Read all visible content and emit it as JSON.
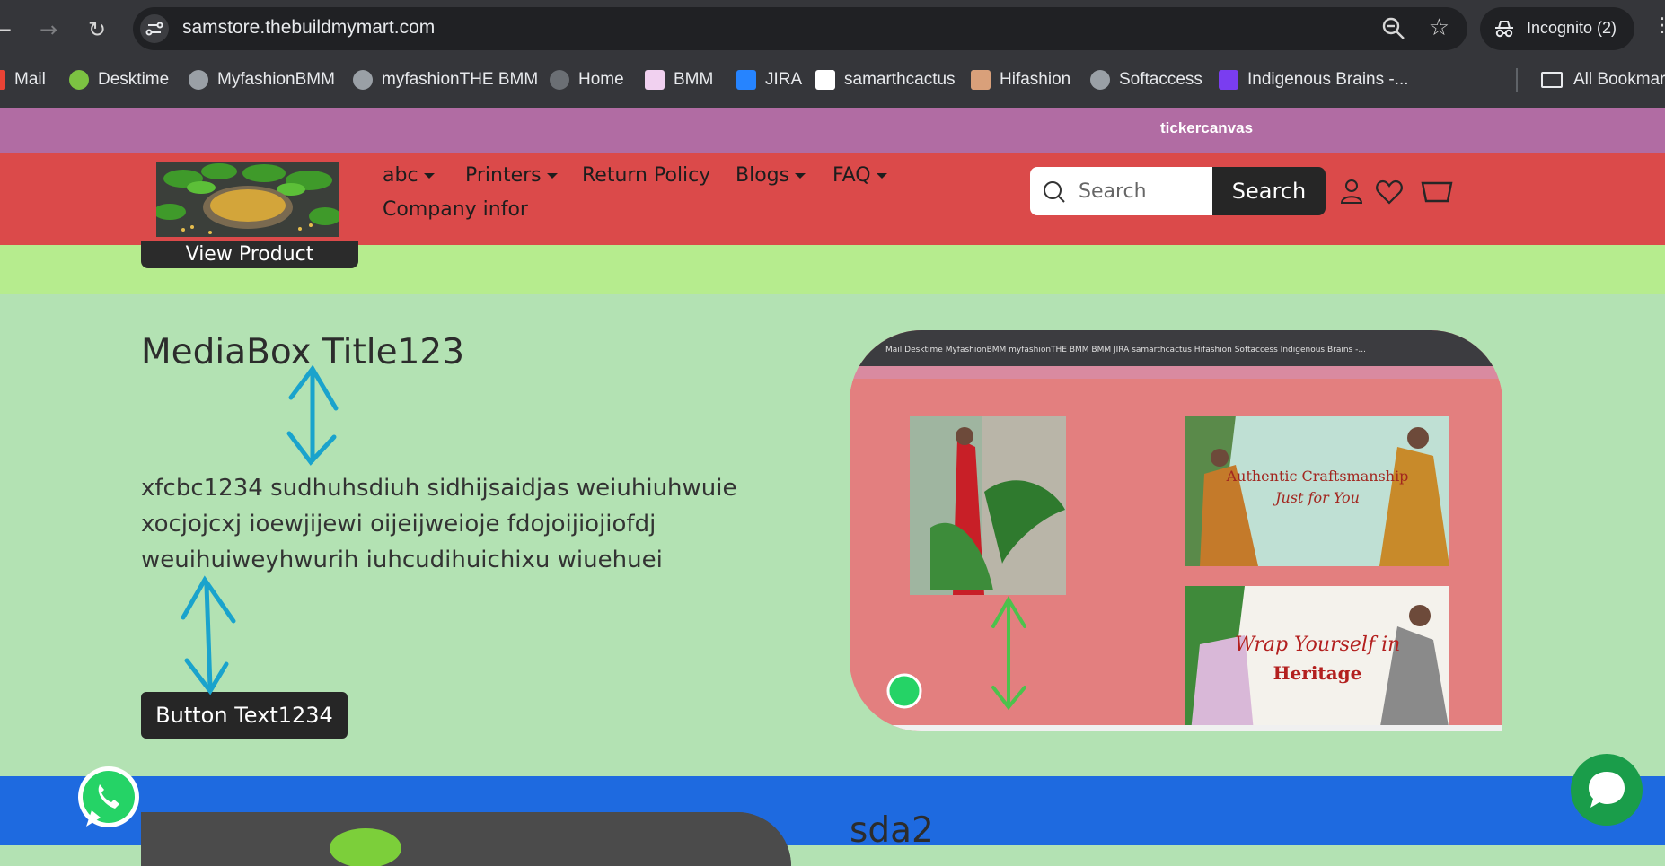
{
  "browser": {
    "url": "samstore.thebuildmymart.com",
    "incognito_label": "Incognito (2)",
    "bookmarks": [
      {
        "label": "Mail",
        "icon": "gmail-icon"
      },
      {
        "label": "Desktime",
        "icon": "desktime-icon"
      },
      {
        "label": "MyfashionBMM",
        "icon": "globe-icon"
      },
      {
        "label": "myfashionTHE BMM",
        "icon": "globe-icon"
      },
      {
        "label": "Home",
        "icon": "globe-icon"
      },
      {
        "label": "BMM",
        "icon": "bmm-icon"
      },
      {
        "label": "JIRA",
        "icon": "jira-icon"
      },
      {
        "label": "samarthcactus",
        "icon": "samarth-icon"
      },
      {
        "label": "Hifashion",
        "icon": "hifashion-icon"
      },
      {
        "label": "Softaccess",
        "icon": "globe-icon"
      },
      {
        "label": "Indigenous Brains -...",
        "icon": "indigenous-icon"
      }
    ],
    "all_bookmarks_label": "All Bookmarks"
  },
  "ticker": {
    "text": "tickercanvas"
  },
  "header": {
    "nav": [
      {
        "label": "abc",
        "has_dropdown": true
      },
      {
        "label": "Printers",
        "has_dropdown": true
      },
      {
        "label": "Return Policy",
        "has_dropdown": false
      },
      {
        "label": "Blogs",
        "has_dropdown": true
      },
      {
        "label": "FAQ",
        "has_dropdown": true
      },
      {
        "label": "Company infor",
        "has_dropdown": false
      }
    ],
    "search_placeholder": "Search",
    "search_button": "Search"
  },
  "hero": {
    "view_product_label": "View Product"
  },
  "mediabox": {
    "title": "MediaBox Title123",
    "body": "xfcbc1234 sudhuhsdiuh sidhijsaidjas weiuhiuhwuie xocjojcxj ioewjijewi oijeijweioje fdojoijiojiofdj weuihuiweyhwurih iuhcudihuichixu wiuehuei",
    "button_label": "Button Text1234",
    "image_captions": {
      "banner1_line1": "Authentic Craftsmanship",
      "banner1_line2": "Just for You",
      "banner2_line1": "Wrap Yourself in",
      "banner2_line2": "Heritage"
    },
    "mini_bookmarks": "Mail  Desktime  MyfashionBMM  myfashionTHE BMM  BMM  JIRA  samarthcactus  Hifashion  Softaccess  Indigenous Brains -..."
  },
  "next_section": {
    "title": "sda2"
  },
  "colors": {
    "ticker": "#b16ca3",
    "header": "#db4a4a",
    "green_band": "#b6ec8e",
    "media_bg": "#b3e2b3",
    "blue_section": "#1e6ae0",
    "annotation_blue": "#1aa3cc",
    "annotation_green": "#4cc24c"
  }
}
